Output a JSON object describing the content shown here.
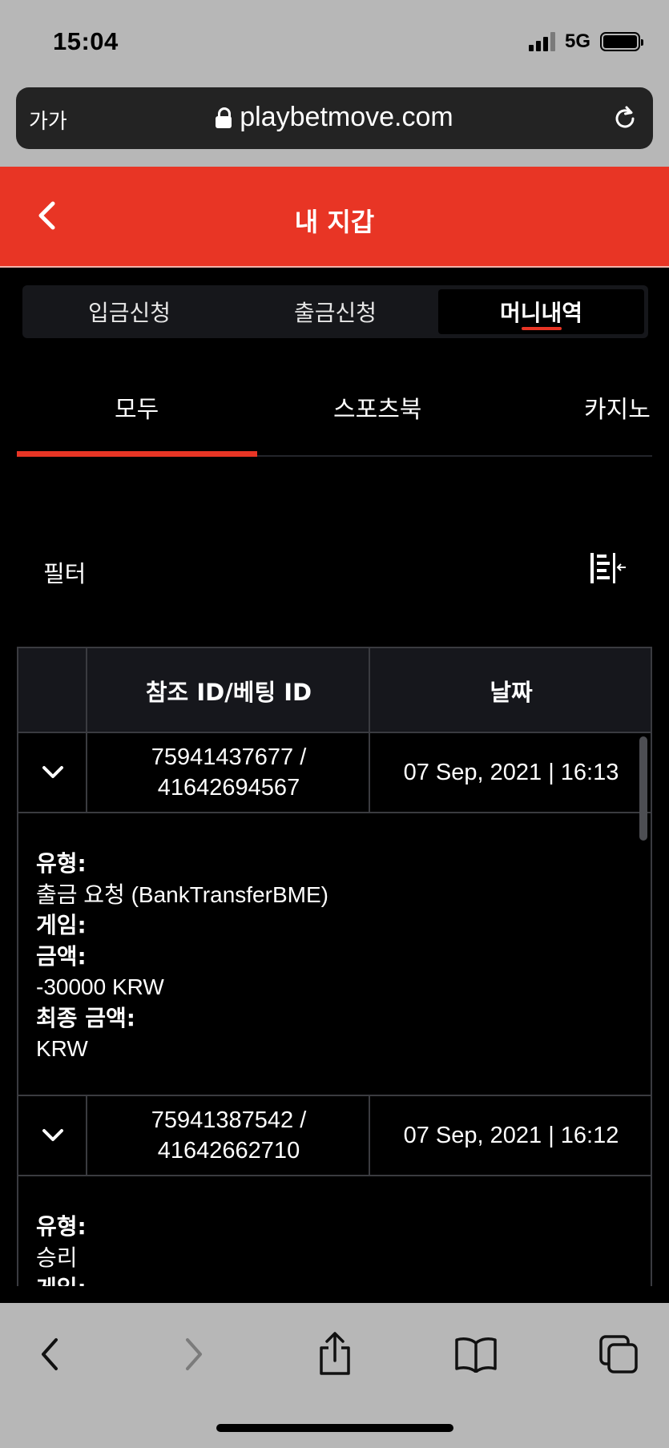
{
  "status_bar": {
    "time": "15:04",
    "network": "5G"
  },
  "browser": {
    "text_size_label": "가가",
    "url": "playbetmove.com"
  },
  "header": {
    "title": "내 지갑"
  },
  "wallet_tabs": [
    "입금신청",
    "출금신청",
    "머니내역"
  ],
  "active_wallet_tab": "머니내역",
  "category_tabs": [
    "모두",
    "스포츠북",
    "카지노"
  ],
  "active_category_tab": "모두",
  "filter": {
    "label": "필터"
  },
  "table": {
    "headers": {
      "ref": "참조 ID/베팅 ID",
      "date": "날짜"
    },
    "rows": [
      {
        "ref_line1": "75941437677 /",
        "ref_line2": "41642694567",
        "date": "07 Sep, 2021 | 16:13",
        "expanded": true,
        "details": {
          "type_label": "유형:",
          "type_value": "출금 요청 (BankTransferBME)",
          "game_label": "게임:",
          "amount_label": "금액:",
          "amount_value": "-30000 KRW",
          "final_label": "최종 금액:",
          "final_value": "KRW"
        }
      },
      {
        "ref_line1": "75941387542 /",
        "ref_line2": "41642662710",
        "date": "07 Sep, 2021 | 16:12",
        "expanded": true,
        "details": {
          "type_label": "유형:",
          "type_value": "승리",
          "game_label": "게임:"
        }
      }
    ]
  },
  "colors": {
    "brand": "#e83525",
    "background": "#000000",
    "surface": "#16171c",
    "border": "#3a3b40",
    "chrome": "#b7b7b7"
  }
}
